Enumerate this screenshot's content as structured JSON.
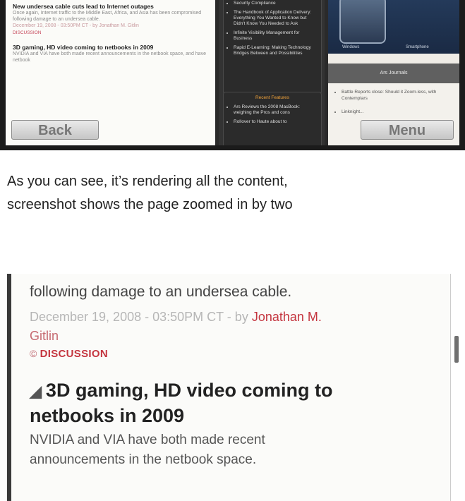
{
  "top_screenshot": {
    "left_column": {
      "stories": [
        {
          "headline": "New undersea cable cuts lead to Internet outages",
          "teaser": "Once again, Internet traffic to the Middle East, Africa, and Asia has been compromised following damage to an undersea cable.",
          "byline": "December 19, 2008 - 03:50PM CT - by Jonathan M. Gitlin",
          "discussion": "DISCUSSION"
        },
        {
          "headline": "3D gaming, HD video coming to netbooks in 2009",
          "teaser": "NVIDIA and VIA have both made recent announcements in the netbook space, and have netbook"
        }
      ]
    },
    "middle_column": {
      "panel_items": [
        "Security Compliance",
        "The Handbook of Application Delivery: Everything You Wanted to Know but Didn't Know You Needed to Ask",
        "Infinite Visibility Management for Business",
        "Rapid E-Learning: Making Technology Bridges Between and Possibilities"
      ],
      "recent_title": "Recent Features",
      "recent_items": [
        "Ars Reviews the 2008 MacBook: weighing the Pros and cons",
        "Rollover to Haute about to"
      ]
    },
    "right_column": {
      "device_captions": [
        "Windows",
        "Smartphone"
      ],
      "journals_title": "Ars Journals",
      "journal_items": [
        "Battle Reports close: Should it Zoom-less, with Contemplars",
        "Linknight..."
      ]
    },
    "softkeys": {
      "back": "Back",
      "menu": "Menu"
    }
  },
  "caption": {
    "line1": "As you can see, it’s rendering all the content,",
    "line2": "screenshot shows the page zoomed in by two"
  },
  "bottom_screenshot": {
    "teaser_end": "following damage to an undersea cable.",
    "date": "December 19, 2008 - 03:50PM CT - by",
    "author_first": "Jonathan M.",
    "author_last": "Gitlin",
    "discussion_icon": "©",
    "discussion": "DISCUSSION",
    "headline_line1": "3D gaming, HD video coming to",
    "headline_line2": "netbooks in 2009",
    "body_line1": "NVIDIA and VIA have both made recent",
    "body_line2": "announcements in the netbook space."
  }
}
